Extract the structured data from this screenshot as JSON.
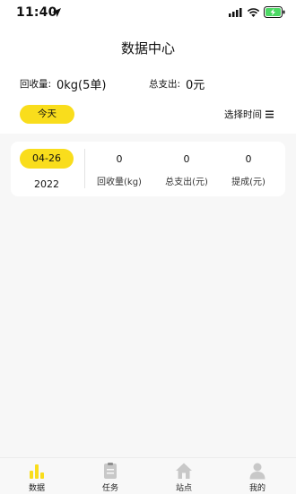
{
  "status_bar": {
    "time": "11:40"
  },
  "header": {
    "title": "数据中心",
    "recycle_label": "回收量:",
    "recycle_value": "0kg(5单)",
    "expense_label": "总支出:",
    "expense_value": "0元",
    "today_button": "今天",
    "select_time": "选择时间"
  },
  "record": {
    "date": "04-26",
    "year": "2022",
    "stats": [
      {
        "value": "0",
        "label": "回收量(kg)"
      },
      {
        "value": "0",
        "label": "总支出(元)"
      },
      {
        "value": "0",
        "label": "提成(元)"
      }
    ]
  },
  "tabbar": {
    "items": [
      {
        "label": "数据",
        "icon": "bar-chart-icon",
        "active": true
      },
      {
        "label": "任务",
        "icon": "clipboard-icon",
        "active": false
      },
      {
        "label": "站点",
        "icon": "home-icon",
        "active": false
      },
      {
        "label": "我的",
        "icon": "user-icon",
        "active": false
      }
    ]
  },
  "colors": {
    "accent": "#f9dd1c",
    "inactive_icon": "#c8c8c8",
    "battery": "#4cd964"
  }
}
